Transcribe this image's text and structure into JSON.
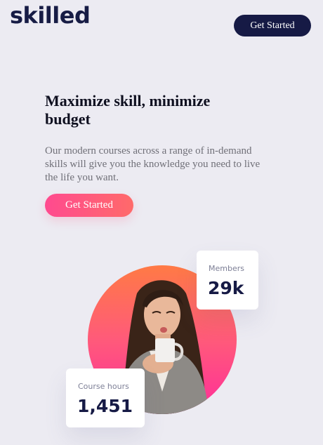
{
  "header": {
    "logo": "skilled",
    "cta_label": "Get Started"
  },
  "hero": {
    "title": "Maximize skill, minimize budget",
    "description": "Our modern courses across a range of in-demand skills will give you the knowledge you need to live the life you want.",
    "cta_label": "Get Started"
  },
  "stats": {
    "members": {
      "label": "Members",
      "value": "29k"
    },
    "course_hours": {
      "label": "Course hours",
      "value": "1,451"
    }
  },
  "colors": {
    "navy": "#161a45",
    "background": "#ecebf2",
    "gradient_start": "#ff4a8f",
    "gradient_end": "#ff6a6a"
  }
}
